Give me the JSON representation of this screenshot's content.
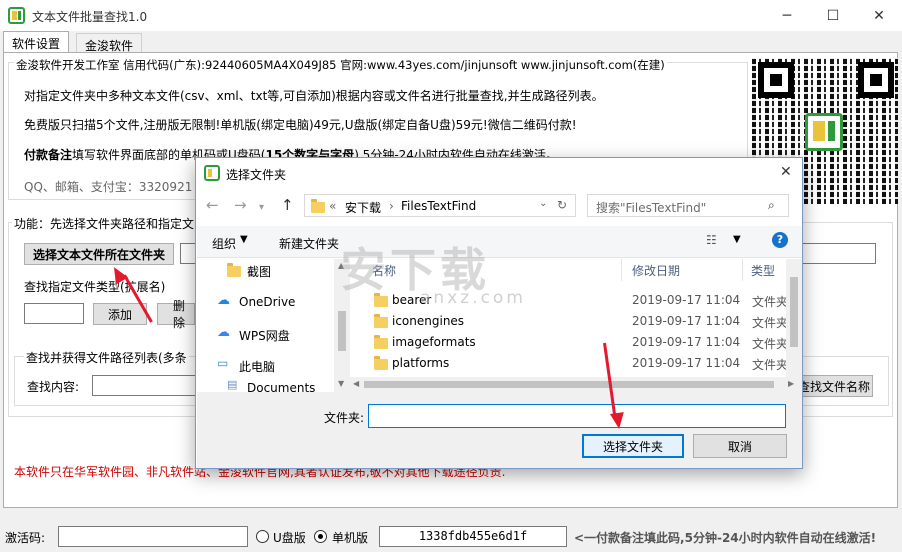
{
  "app": {
    "title": "文本文件批量查找1.0",
    "min_icon": "─",
    "max_icon": "☐",
    "close_icon": "✕"
  },
  "tabs": [
    "软件设置",
    "金浚软件"
  ],
  "info": {
    "line1": "金浚软件开发工作室 信用代码(广东):92440605MA4X049J85 官网:www.43yes.com/jinjunsoft  www.jinjunsoft.com(在建)",
    "line2": "对指定文件夹中多种文本文件(csv、xml、txt等,可自添加)根据内容或文件名进行批量查找,并生成路径列表。",
    "line3": "免费版只扫描5个文件,注册版无限制!单机版(绑定电脑)49元,U盘版(绑定自备U盘)59元!微信二维码付款!",
    "line4_bold": "付款备注",
    "line4_a": "填写软件界面底部的单机码或U盘码(",
    "line4_b": "15个数字与字母",
    "line4_c": "),5分钟-24小时内软件自动在线激活。",
    "line5": "QQ、邮箱、支付宝：3320921"
  },
  "function": {
    "label": "功能：先选择文件夹路径和指定文",
    "select_folder_button": "选择文本文件所在文件夹",
    "types_label": "查找指定文件类型(扩展名)",
    "add_button": "添加",
    "delete_button": "删除",
    "search_label": "查找并获得文件路径列表(多条",
    "content_label": "查找内容:",
    "find_name_button": "查找文件名称"
  },
  "notice": "本软件只在华军软件园、非凡软件站、金浚软件官网,其者认证发布,敬不对其他下载途径负责.",
  "status": {
    "activation_label": "激活码:",
    "usb_label": "U盘版",
    "pc_label": "单机版",
    "machine_code": "1338fdb455e6d1f",
    "hint": "<一付款备注填此码,5分钟-24小时内软件自动在线激活!"
  },
  "dialog": {
    "title": "选择文件夹",
    "path_prefix": "«",
    "path_parts": [
      "安下载",
      "FilesTextFind"
    ],
    "search_placeholder": "搜索\"FilesTextFind\"",
    "organize": "组织",
    "new_folder": "新建文件夹",
    "nav_items": [
      "截图",
      "OneDrive",
      "WPS网盘",
      "此电脑",
      "Documents"
    ],
    "columns": [
      "名称",
      "修改日期",
      "类型"
    ],
    "files": [
      {
        "name": "bearer",
        "date": "2019-09-17 11:04",
        "type": "文件夹"
      },
      {
        "name": "iconengines",
        "date": "2019-09-17 11:04",
        "type": "文件夹"
      },
      {
        "name": "imageformats",
        "date": "2019-09-17 11:04",
        "type": "文件夹"
      },
      {
        "name": "platforms",
        "date": "2019-09-17 11:04",
        "type": "文件夹"
      }
    ],
    "folder_label": "文件夹:",
    "folder_value": "",
    "ok_button": "选择文件夹",
    "cancel_button": "取消",
    "help_icon": "?"
  },
  "watermark": {
    "main": "安下载",
    "sub": "anxz.com"
  },
  "colors": {
    "accent": "#0078d7",
    "notice": "#d00000",
    "arrow": "#e5192d",
    "brand_green": "#2e9a3b"
  }
}
